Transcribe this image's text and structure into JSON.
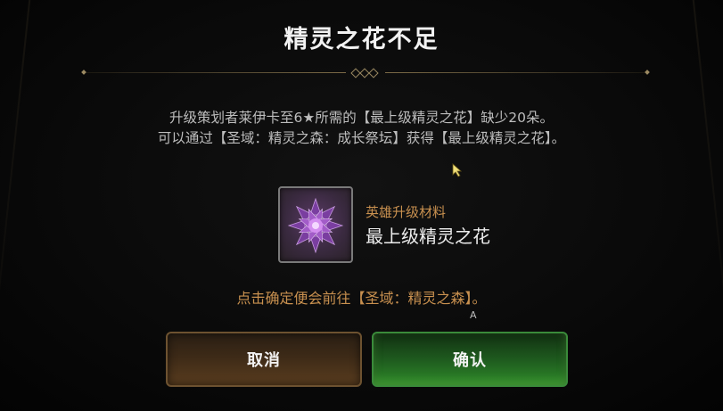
{
  "dialog": {
    "title": "精灵之花不足",
    "message_line1": "升级策划者莱伊卡至6★所需的【最上级精灵之花】缺少20朵。",
    "message_line2": "可以通过【圣域：精灵之森：成长祭坛】获得【最上级精灵之花】。",
    "item": {
      "icon": "purple-spirit-flower-icon",
      "category": "英雄升级材料",
      "name": "最上级精灵之花"
    },
    "hint": "点击确定便会前往【圣域：精灵之森】。",
    "marker": "A",
    "cancel_label": "取消",
    "confirm_label": "确认"
  },
  "colors": {
    "accent_orange": "#c8904f",
    "confirm_green": "#2f8a2a",
    "cancel_brown": "#5a3d1f",
    "text_light": "#f2f2f2"
  }
}
